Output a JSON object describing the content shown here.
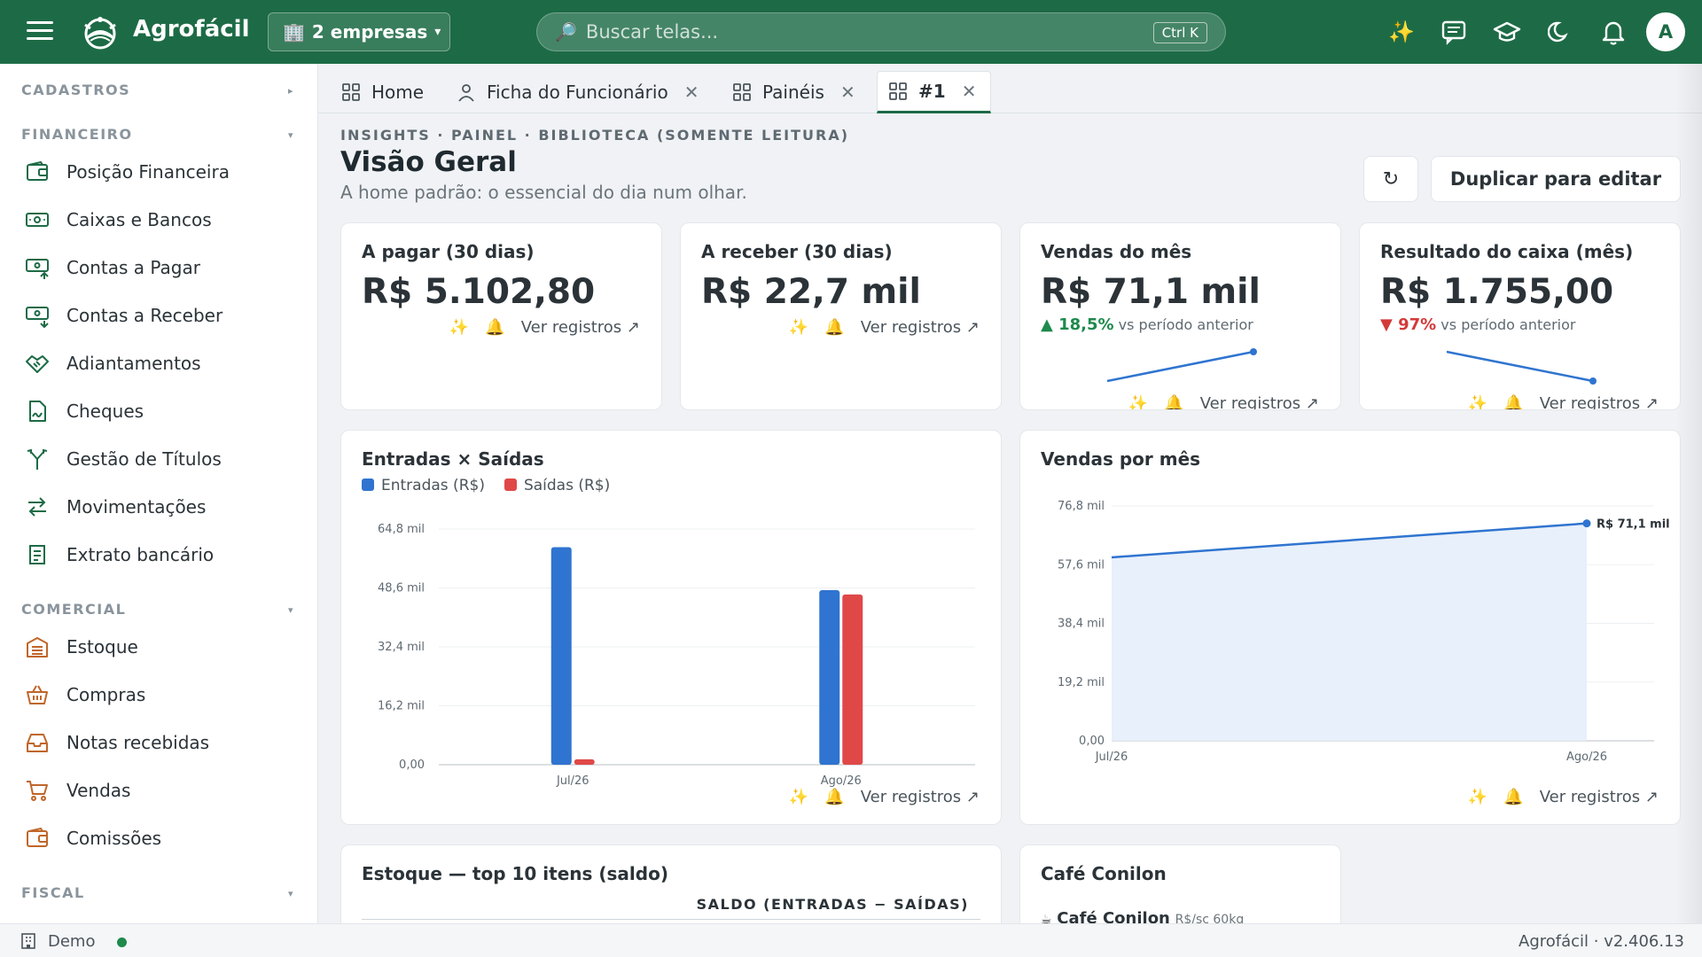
{
  "app": {
    "brand": "Agrofácil"
  },
  "topbar": {
    "company_selector": "2 empresas",
    "search_placeholder": "Buscar telas...",
    "search_shortcut": "Ctrl K",
    "avatar_initial": "A"
  },
  "sidebar": {
    "sections": [
      {
        "label": "CADASTROS",
        "arrow": "▸"
      },
      {
        "label": "FINANCEIRO",
        "arrow": "▾",
        "items": [
          "Posição Financeira",
          "Caixas e Bancos",
          "Contas a Pagar",
          "Contas a Receber",
          "Adiantamentos",
          "Cheques",
          "Gestão de Títulos",
          "Movimentações",
          "Extrato bancário"
        ]
      },
      {
        "label": "COMERCIAL",
        "arrow": "▾",
        "items": [
          "Estoque",
          "Compras",
          "Notas recebidas",
          "Vendas",
          "Comissões"
        ]
      },
      {
        "label": "FISCAL",
        "arrow": "▾"
      }
    ]
  },
  "tabs": [
    {
      "label": "Home",
      "closable": false
    },
    {
      "label": "Ficha do Funcionário",
      "closable": true
    },
    {
      "label": "Painéis",
      "closable": true
    },
    {
      "label": "#1",
      "closable": true,
      "active": true
    }
  ],
  "header": {
    "eyebrow": "INSIGHTS · PAINEL · BIBLIOTECA (SOMENTE LEITURA)",
    "title": "Visão Geral",
    "subtitle": "A home padrão: o essencial do dia num olhar.",
    "refresh_label": "↻",
    "duplicate_label": "Duplicar para editar"
  },
  "kpis": [
    {
      "title": "A pagar (30 dias)",
      "value": "R$ 5.102,80"
    },
    {
      "title": "A receber (30 dias)",
      "value": "R$ 22,7 mil"
    },
    {
      "title": "Vendas do mês",
      "value": "R$ 71,1 mil",
      "delta": "▲ 18,5%",
      "delta_text": "vs período anterior",
      "trend": [
        0.0,
        1.0
      ]
    },
    {
      "title": "Resultado do caixa (mês)",
      "value": "R$ 1.755,00",
      "delta": "▼ 97%",
      "delta_text": "vs período anterior",
      "trend": [
        1.0,
        0.0
      ]
    }
  ],
  "actions": {
    "link": "Ver registros ↗",
    "sparkle": "✨",
    "bell": "🔔"
  },
  "colors": {
    "primary": "#1d6b46",
    "entradas": "#2f74d0",
    "saidas": "#e04848",
    "positive": "#1e8a4c",
    "negative": "#d33a3a"
  },
  "chart_data": [
    {
      "type": "bar",
      "title": "Entradas × Saídas",
      "categories": [
        "Jul/26",
        "Ago/26"
      ],
      "series": [
        {
          "name": "Entradas (R$)",
          "values": [
            59800,
            48000
          ]
        },
        {
          "name": "Saídas (R$)",
          "values": [
            1500,
            46800
          ]
        }
      ],
      "yticks": [
        "0,00",
        "16,2 mil",
        "32,4 mil",
        "48,6 mil",
        "64,8 mil"
      ],
      "ylim": [
        0,
        64800
      ],
      "grid": true,
      "legend": "top-left"
    },
    {
      "type": "area",
      "title": "Vendas por mês",
      "categories": [
        "Jul/26",
        "Ago/26"
      ],
      "series": [
        {
          "values": [
            60000,
            71100
          ]
        }
      ],
      "point_label": "R$ 71,1 mil",
      "yticks": [
        "0,00",
        "19,2 mil",
        "38,4 mil",
        "57,6 mil",
        "76,8 mil"
      ],
      "ylim": [
        0,
        76800
      ],
      "grid": true
    }
  ],
  "bottom_cards": {
    "estoque_title": "Estoque — top 10 itens (saldo)",
    "estoque_column": "SALDO (ENTRADAS − SAÍDAS)",
    "cafe_title": "Café Conilon",
    "cafe_item": "Café Conilon",
    "cafe_unit": "R$/sc 60kg"
  },
  "status": {
    "env": "Demo",
    "version": "Agrofácil · v2.406.13"
  }
}
